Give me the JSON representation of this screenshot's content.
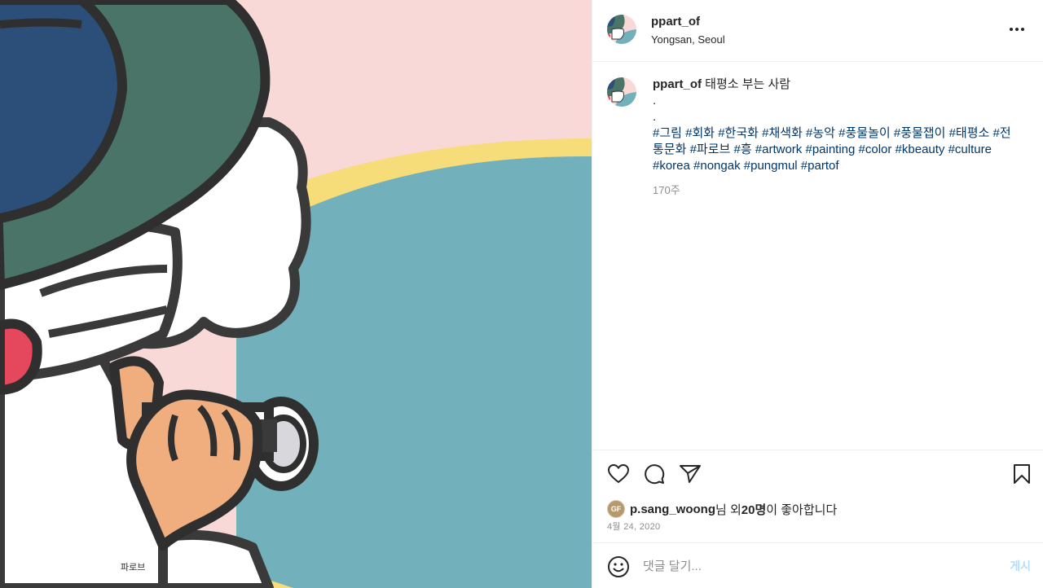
{
  "post": {
    "username": "ppart_of",
    "location": "Yongsan, Seoul"
  },
  "caption": {
    "username": "ppart_of",
    "text": "태평소 부는 사람",
    "dot1": ".",
    "dot2": ".",
    "hashtags_line1": "#그림 #회화 #한국화 #채색화 #농악 #풍물놀이 #풍물잽이 #태평소 #전",
    "hashtags_line2": "통문화 #파로브 #흥 #artwork #painting #color #kbeauty #culture",
    "hashtags_line3": "#korea #nongak #pungmul #partof",
    "time_ago": "170주"
  },
  "artwork": {
    "signature": "파로브"
  },
  "icons": {
    "more": "more-options-icon",
    "like": "heart-icon",
    "comment": "comment-icon",
    "share": "paper-plane-icon",
    "save": "bookmark-icon",
    "emoji": "emoji-icon"
  },
  "likes": {
    "avatar_initials": "GF",
    "user": "p.sang_woong",
    "text1": "님 외 ",
    "count": "20명",
    "text2": "이 좋아합니다"
  },
  "date": "4월 24, 2020",
  "comment_box": {
    "placeholder": "댓글 달기...",
    "post_label": "게시"
  },
  "colors": {
    "background_pink": "#f8d9d8",
    "teal": "#72b0bc",
    "yellow": "#f7dc7a",
    "hat_green": "#4a7468",
    "hat_blue": "#2c4f7a",
    "skin": "#f0ae7f",
    "red": "#e5475c",
    "hashtag": "#00376b",
    "post_button": "#b2dffc"
  }
}
